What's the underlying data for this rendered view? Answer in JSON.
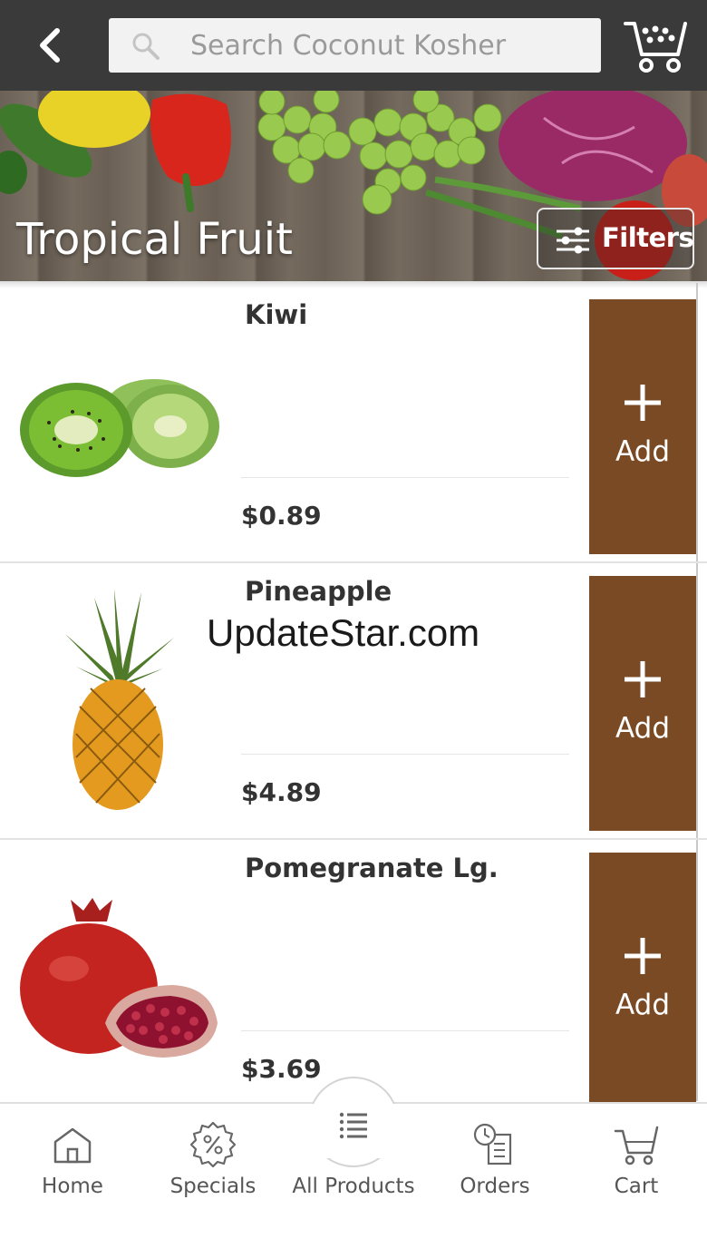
{
  "header": {
    "back_icon": "chevron-left-icon",
    "search_placeholder": "Search Coconut Kosher",
    "cart_icon": "shopping-cart-icon"
  },
  "hero": {
    "title": "Tropical Fruit",
    "filters_label": "Filters"
  },
  "products": [
    {
      "name": "Kiwi",
      "price": "$0.89",
      "add_label": "Add"
    },
    {
      "name": "Pineapple",
      "price": "$4.89",
      "add_label": "Add"
    },
    {
      "name": "Pomegranate Lg.",
      "price": "$3.69",
      "add_label": "Add"
    }
  ],
  "watermark": "UpdateStar.com",
  "bottom_nav": {
    "items": [
      {
        "label": "Home",
        "icon": "home-icon"
      },
      {
        "label": "Specials",
        "icon": "percent-badge-icon"
      },
      {
        "label": "All Products",
        "icon": "list-icon"
      },
      {
        "label": "Orders",
        "icon": "clock-document-icon"
      },
      {
        "label": "Cart",
        "icon": "shopping-cart-icon"
      }
    ]
  },
  "colors": {
    "topbar": "#3a3a3a",
    "add_button": "#7a4a24",
    "nav_text": "#555555"
  }
}
